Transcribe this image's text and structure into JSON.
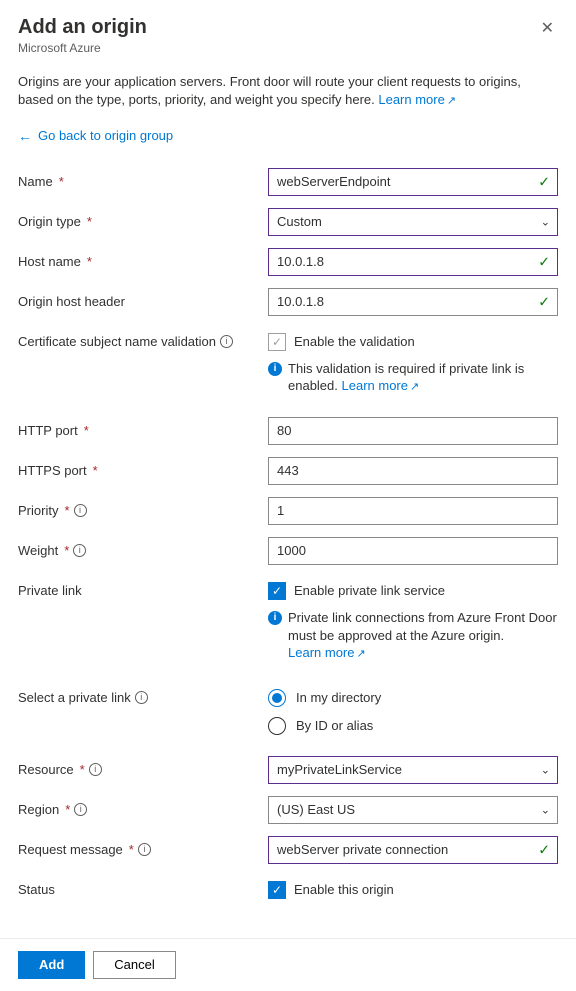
{
  "header": {
    "title": "Add an origin",
    "subtitle": "Microsoft Azure"
  },
  "intro": {
    "text": "Origins are your application servers. Front door will route your client requests to origins, based on the type, ports, priority, and weight you specify here. ",
    "learn_more": "Learn more"
  },
  "back_link": "Go back to origin group",
  "fields": {
    "name": {
      "label": "Name",
      "value": "webServerEndpoint"
    },
    "origin_type": {
      "label": "Origin type",
      "value": "Custom"
    },
    "host_name": {
      "label": "Host name",
      "value": "10.0.1.8"
    },
    "origin_host_header": {
      "label": "Origin host header",
      "value": "10.0.1.8"
    },
    "cert_validation": {
      "label": "Certificate subject name validation",
      "checkbox_label": "Enable the validation",
      "note": "This validation is required if private link is enabled. ",
      "learn_more": "Learn more"
    },
    "http_port": {
      "label": "HTTP port",
      "value": "80"
    },
    "https_port": {
      "label": "HTTPS port",
      "value": "443"
    },
    "priority": {
      "label": "Priority",
      "value": "1"
    },
    "weight": {
      "label": "Weight",
      "value": "1000"
    },
    "private_link": {
      "label": "Private link",
      "checkbox_label": "Enable private link service",
      "note": "Private link connections from Azure Front Door must be approved at the Azure origin. ",
      "learn_more": "Learn more"
    },
    "select_private_link": {
      "label": "Select a private link",
      "opt1": "In my directory",
      "opt2": "By ID or alias"
    },
    "resource": {
      "label": "Resource",
      "value": "myPrivateLinkService"
    },
    "region": {
      "label": "Region",
      "value": "(US) East US"
    },
    "request_message": {
      "label": "Request message",
      "value": "webServer private connection"
    },
    "status": {
      "label": "Status",
      "checkbox_label": "Enable this origin"
    }
  },
  "footer": {
    "add": "Add",
    "cancel": "Cancel"
  }
}
